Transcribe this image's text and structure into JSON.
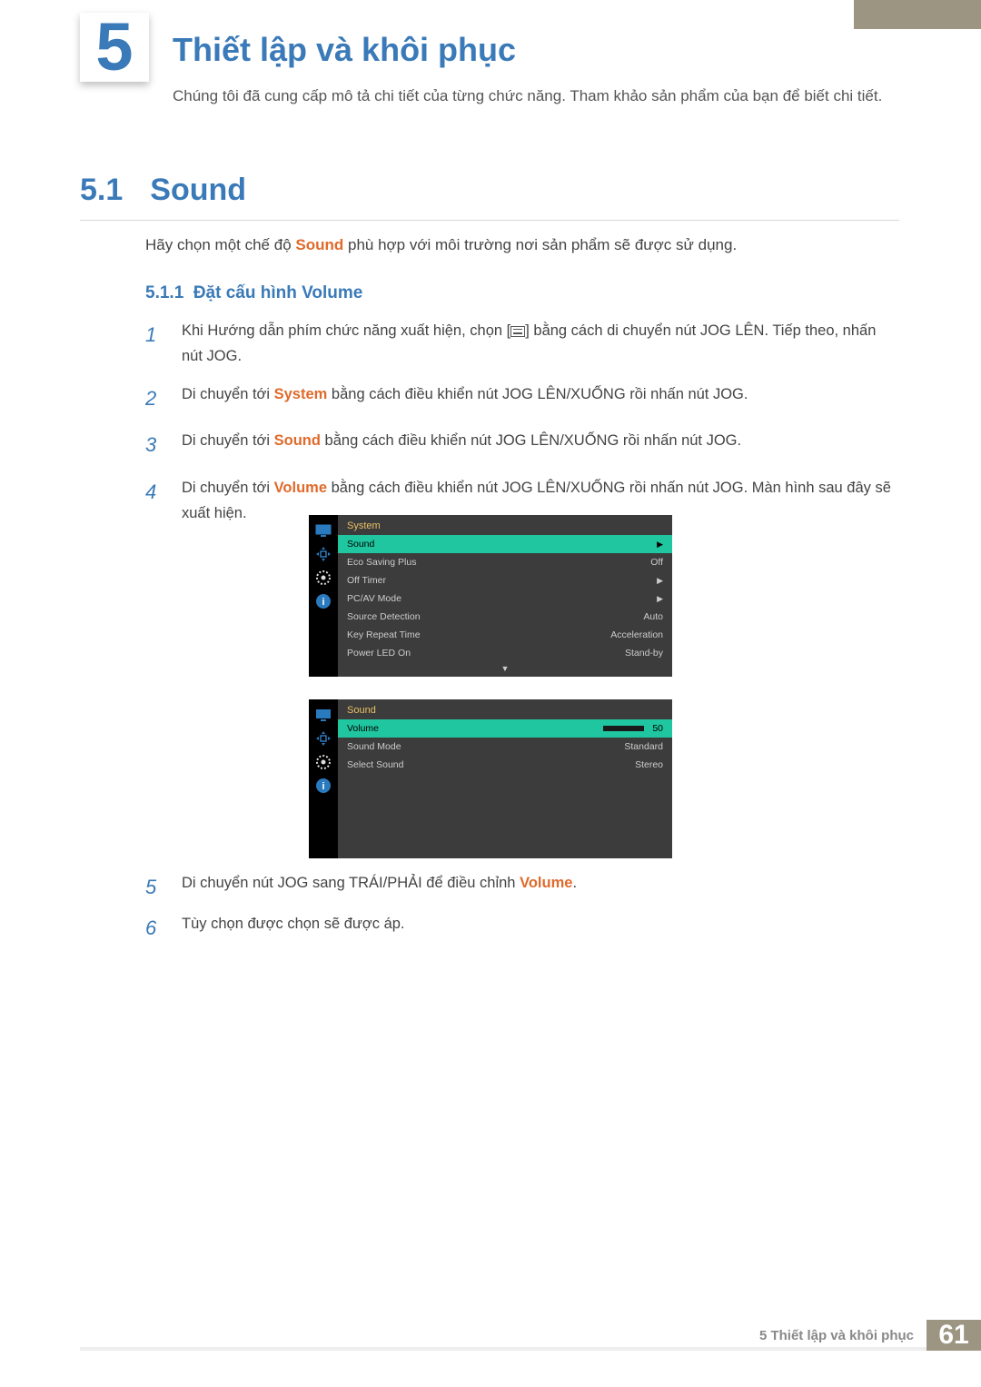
{
  "chapter": {
    "number": "5",
    "title": "Thiết lập và khôi phục",
    "intro": "Chúng tôi đã cung cấp mô tả chi tiết của từng chức năng. Tham khảo sản phẩm của bạn để biết chi tiết."
  },
  "section": {
    "number": "5.1",
    "title": "Sound",
    "text_pre": "Hãy chọn một chế độ ",
    "text_hl": "Sound",
    "text_post": " phù hợp với môi trường nơi sản phẩm sẽ được sử dụng."
  },
  "subsection": {
    "number": "5.1.1",
    "title": "Đặt cấu hình Volume"
  },
  "steps": [
    {
      "n": "1",
      "pre": "Khi Hướng dẫn phím chức năng xuất hiện, chọn [",
      "post": "] bằng cách di chuyển nút JOG LÊN. Tiếp theo, nhấn nút JOG.",
      "icon": true
    },
    {
      "n": "2",
      "pre": "Di chuyển tới ",
      "hl": "System",
      "post": " bằng cách điều khiển nút JOG LÊN/XUỐNG rồi nhấn nút JOG."
    },
    {
      "n": "3",
      "pre": "Di chuyển tới ",
      "hl": "Sound",
      "post": " bằng cách điều khiển nút JOG LÊN/XUỐNG rồi nhấn nút JOG."
    },
    {
      "n": "4",
      "pre": "Di chuyển tới ",
      "hl": "Volume",
      "post": " bằng cách điều khiển nút JOG LÊN/XUỐNG rồi nhấn nút JOG. Màn hình sau đây sẽ xuất hiện."
    }
  ],
  "osd1": {
    "header": "System",
    "highlight": {
      "label": "Sound",
      "value": "▶"
    },
    "rows": [
      {
        "label": "Eco Saving Plus",
        "value": "Off"
      },
      {
        "label": "Off Timer",
        "value": "▶"
      },
      {
        "label": "PC/AV Mode",
        "value": "▶"
      },
      {
        "label": "Source Detection",
        "value": "Auto"
      },
      {
        "label": "Key Repeat Time",
        "value": "Acceleration"
      },
      {
        "label": "Power LED On",
        "value": "Stand-by"
      }
    ],
    "footer": "▼"
  },
  "osd2": {
    "header": "Sound",
    "highlight": {
      "label": "Volume",
      "value": "50",
      "bar": true
    },
    "rows": [
      {
        "label": "Sound Mode",
        "value": "Standard"
      },
      {
        "label": "Select Sound",
        "value": "Stereo"
      }
    ]
  },
  "steps_lower": [
    {
      "n": "5",
      "pre": "Di chuyển nút JOG sang TRÁI/PHẢI để điều chỉnh ",
      "hl": "Volume",
      "post": "."
    },
    {
      "n": "6",
      "pre": "Tùy chọn được chọn sẽ được áp."
    }
  ],
  "footer": {
    "text": "5 Thiết lập và khôi phục",
    "page": "61"
  }
}
